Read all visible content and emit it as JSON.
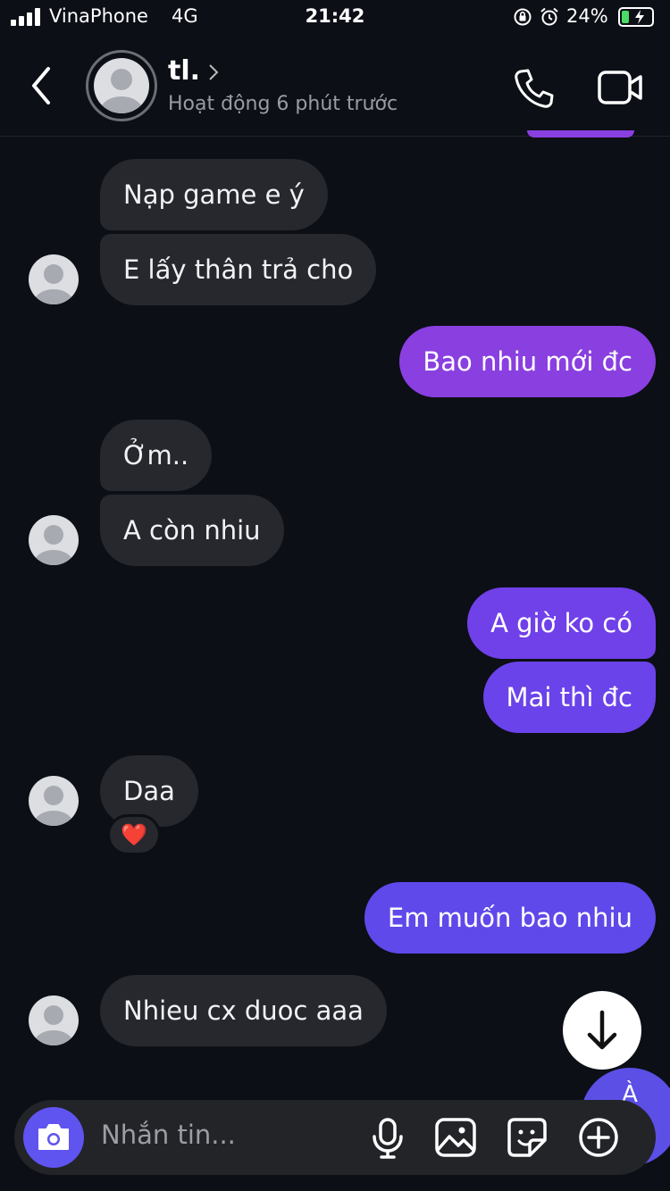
{
  "status_bar": {
    "carrier": "VinaPhone",
    "network": "4G",
    "time": "21:42",
    "battery_percent": "24%",
    "battery_level": 0.24,
    "battery_color": "#4cd964"
  },
  "header": {
    "contact_name": "tl.",
    "activity": "Hoạt động 6 phút trước",
    "icons": [
      "back-chevron-icon",
      "profile-chevron-icon",
      "phone-icon",
      "video-call-icon"
    ]
  },
  "messages": [
    {
      "sender": "contact",
      "text": "Nạp game e ý"
    },
    {
      "sender": "contact",
      "text": "E lấy thân trả cho"
    },
    {
      "sender": "me",
      "text": "Bao nhiu mới đc"
    },
    {
      "sender": "contact",
      "text": "Ởm.."
    },
    {
      "sender": "contact",
      "text": "A còn nhiu"
    },
    {
      "sender": "me",
      "text": "A giờ ko có"
    },
    {
      "sender": "me",
      "text": "Mai thì đc"
    },
    {
      "sender": "contact",
      "text": "Daa",
      "reaction": "❤️"
    },
    {
      "sender": "me",
      "text": "Em muốn bao nhiu"
    },
    {
      "sender": "contact",
      "text": "Nhieu cx duoc aaa"
    },
    {
      "sender": "me",
      "text": "À"
    }
  ],
  "composer": {
    "placeholder": "Nhắn tin...",
    "icons": [
      "camera-icon",
      "microphone-icon",
      "gallery-icon",
      "sticker-icon",
      "plus-icon"
    ]
  },
  "colors": {
    "background": "#0c0f16",
    "incoming_bubble": "#26282e",
    "outgoing_purple": "#8a3fe0",
    "outgoing_indigo": "#5b4fe6",
    "camera_button": "#5f54ef"
  }
}
